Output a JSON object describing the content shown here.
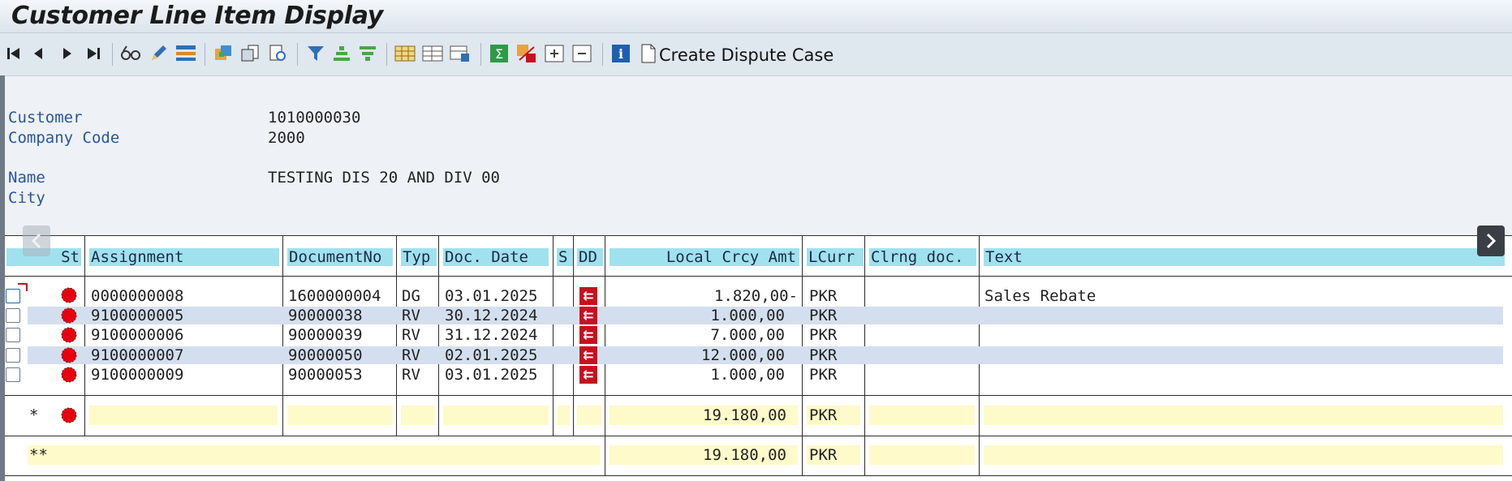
{
  "title": "Customer Line Item Display",
  "toolbar": {
    "icons": [
      "first-page",
      "previous-page",
      "next-page",
      "last-page",
      "display-glasses",
      "change-pencil",
      "select-layout",
      "document-colored",
      "document-copy",
      "document-view",
      "filter",
      "sort-ascending",
      "sort-descending",
      "layout-grid",
      "layout-expand",
      "layout-change",
      "sum",
      "subtotal",
      "expand-all",
      "collapse-all",
      "info"
    ],
    "create_dispute_label": "Create Dispute Case"
  },
  "header": {
    "customer_label": "Customer",
    "customer_value": "1010000030",
    "company_code_label": "Company Code",
    "company_code_value": "2000",
    "name_label": "Name",
    "name_value": "TESTING DIS 20 AND DIV 00",
    "city_label": "City",
    "city_value": ""
  },
  "table": {
    "columns": [
      "St",
      "Assignment",
      "DocumentNo",
      "Typ",
      "Doc. Date",
      "S",
      "DD",
      "Local Crcy Amt",
      "LCurr",
      "Clrng doc.",
      "Text"
    ],
    "rows": [
      {
        "assignment": "0000000008",
        "document_no": "1600000004",
        "typ": "DG",
        "doc_date": "03.01.2025",
        "amount": "1.820,00-",
        "currency": "PKR",
        "clearing": "",
        "text": "Sales Rebate"
      },
      {
        "assignment": "9100000005",
        "document_no": "90000038",
        "typ": "RV",
        "doc_date": "30.12.2024",
        "amount": "1.000,00",
        "currency": "PKR",
        "clearing": "",
        "text": ""
      },
      {
        "assignment": "9100000006",
        "document_no": "90000039",
        "typ": "RV",
        "doc_date": "31.12.2024",
        "amount": "7.000,00",
        "currency": "PKR",
        "clearing": "",
        "text": ""
      },
      {
        "assignment": "9100000007",
        "document_no": "90000050",
        "typ": "RV",
        "doc_date": "02.01.2025",
        "amount": "12.000,00",
        "currency": "PKR",
        "clearing": "",
        "text": ""
      },
      {
        "assignment": "9100000009",
        "document_no": "90000053",
        "typ": "RV",
        "doc_date": "03.01.2025",
        "amount": "1.000,00",
        "currency": "PKR",
        "clearing": "",
        "text": ""
      }
    ],
    "subtotal": {
      "marker": "*",
      "amount": "19.180,00",
      "currency": "PKR"
    },
    "total": {
      "marker": "**",
      "amount": "19.180,00",
      "currency": "PKR"
    }
  },
  "colors": {
    "header_cell": "#9fe2ee",
    "row_alt": "#d3dfee",
    "sum_row": "#fffac9",
    "status_red": "#e8000f",
    "dd_icon": "#c8101e",
    "label_blue": "#2a55a2"
  }
}
